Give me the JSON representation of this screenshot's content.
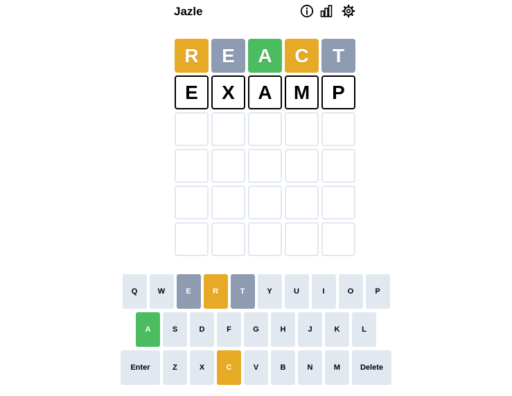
{
  "app": {
    "title": "Jazle"
  },
  "header": {
    "icons": [
      "info-icon",
      "stats-chart-icon",
      "settings-gear-icon"
    ]
  },
  "colors": {
    "correct": "#4bbc5f",
    "present": "#e6aa27",
    "absent": "#8e9bb1",
    "key_default": "#e2e8f0",
    "empty_border": "#e2e8f0"
  },
  "board": {
    "rows": [
      [
        {
          "letter": "R",
          "state": "present"
        },
        {
          "letter": "E",
          "state": "absent"
        },
        {
          "letter": "A",
          "state": "correct"
        },
        {
          "letter": "C",
          "state": "present"
        },
        {
          "letter": "T",
          "state": "absent"
        }
      ],
      [
        {
          "letter": "E",
          "state": "filled"
        },
        {
          "letter": "X",
          "state": "filled"
        },
        {
          "letter": "A",
          "state": "filled"
        },
        {
          "letter": "M",
          "state": "filled"
        },
        {
          "letter": "P",
          "state": "filled"
        }
      ],
      [
        {
          "letter": "",
          "state": "empty"
        },
        {
          "letter": "",
          "state": "empty"
        },
        {
          "letter": "",
          "state": "empty"
        },
        {
          "letter": "",
          "state": "empty"
        },
        {
          "letter": "",
          "state": "empty"
        }
      ],
      [
        {
          "letter": "",
          "state": "empty"
        },
        {
          "letter": "",
          "state": "empty"
        },
        {
          "letter": "",
          "state": "empty"
        },
        {
          "letter": "",
          "state": "empty"
        },
        {
          "letter": "",
          "state": "empty"
        }
      ],
      [
        {
          "letter": "",
          "state": "empty"
        },
        {
          "letter": "",
          "state": "empty"
        },
        {
          "letter": "",
          "state": "empty"
        },
        {
          "letter": "",
          "state": "empty"
        },
        {
          "letter": "",
          "state": "empty"
        }
      ],
      [
        {
          "letter": "",
          "state": "empty"
        },
        {
          "letter": "",
          "state": "empty"
        },
        {
          "letter": "",
          "state": "empty"
        },
        {
          "letter": "",
          "state": "empty"
        },
        {
          "letter": "",
          "state": "empty"
        }
      ]
    ]
  },
  "keyboard": {
    "rows": [
      [
        {
          "label": "Q",
          "state": ""
        },
        {
          "label": "W",
          "state": ""
        },
        {
          "label": "E",
          "state": "absent"
        },
        {
          "label": "R",
          "state": "present"
        },
        {
          "label": "T",
          "state": "absent"
        },
        {
          "label": "Y",
          "state": ""
        },
        {
          "label": "U",
          "state": ""
        },
        {
          "label": "I",
          "state": ""
        },
        {
          "label": "O",
          "state": ""
        },
        {
          "label": "P",
          "state": ""
        }
      ],
      [
        {
          "label": "A",
          "state": "correct"
        },
        {
          "label": "S",
          "state": ""
        },
        {
          "label": "D",
          "state": ""
        },
        {
          "label": "F",
          "state": ""
        },
        {
          "label": "G",
          "state": ""
        },
        {
          "label": "H",
          "state": ""
        },
        {
          "label": "J",
          "state": ""
        },
        {
          "label": "K",
          "state": ""
        },
        {
          "label": "L",
          "state": ""
        }
      ],
      [
        {
          "label": "Enter",
          "state": "",
          "wide": true
        },
        {
          "label": "Z",
          "state": ""
        },
        {
          "label": "X",
          "state": ""
        },
        {
          "label": "C",
          "state": "present"
        },
        {
          "label": "V",
          "state": ""
        },
        {
          "label": "B",
          "state": ""
        },
        {
          "label": "N",
          "state": ""
        },
        {
          "label": "M",
          "state": ""
        },
        {
          "label": "Delete",
          "state": "",
          "wide": true
        }
      ]
    ]
  }
}
